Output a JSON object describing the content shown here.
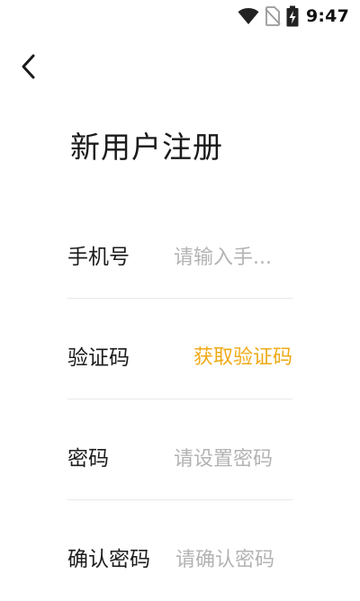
{
  "status_bar": {
    "time": "9:47",
    "icons": [
      "wifi-icon",
      "no-sim-icon",
      "battery-charging-icon"
    ]
  },
  "header": {
    "back_icon": "chevron-left-icon"
  },
  "page": {
    "title": "新用户注册"
  },
  "form": {
    "phone": {
      "label": "手机号",
      "placeholder": "请输入手..."
    },
    "verification_code": {
      "label": "验证码",
      "button_label": "获取验证码",
      "button_color": "#efaa16"
    },
    "password": {
      "label": "密码",
      "placeholder": "请设置密码"
    },
    "confirm_password": {
      "label": "确认密码",
      "placeholder": "请确认密码"
    }
  }
}
